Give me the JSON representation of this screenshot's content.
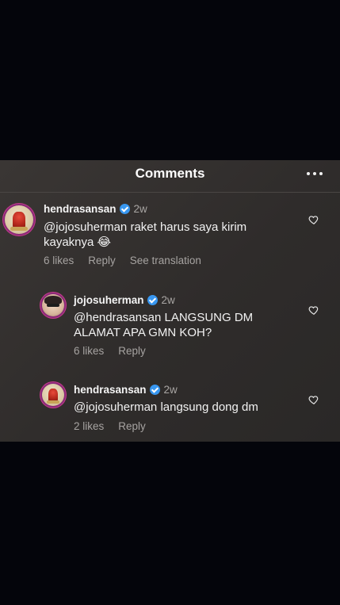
{
  "header": {
    "title": "Comments"
  },
  "comments": [
    {
      "username": "hendrasansan",
      "time": "2w",
      "text": "@jojosuherman raket harus saya kirim kayaknya 😂",
      "likes": "6 likes",
      "reply": "Reply",
      "translate": "See translation"
    },
    {
      "username": "jojosuherman",
      "time": "2w",
      "text": "@hendrasansan LANGSUNG DM ALAMAT APA GMN KOH?",
      "likes": "6 likes",
      "reply": "Reply"
    },
    {
      "username": "hendrasansan",
      "time": "2w",
      "text": "@jojosuherman langsung dong dm",
      "likes": "2 likes",
      "reply": "Reply"
    }
  ],
  "colors": {
    "verified": "#3897f0",
    "panel": "#33302f",
    "story_ring": "#c33b8b"
  },
  "icons": [
    "more-icon",
    "verified-icon",
    "heart-icon"
  ]
}
